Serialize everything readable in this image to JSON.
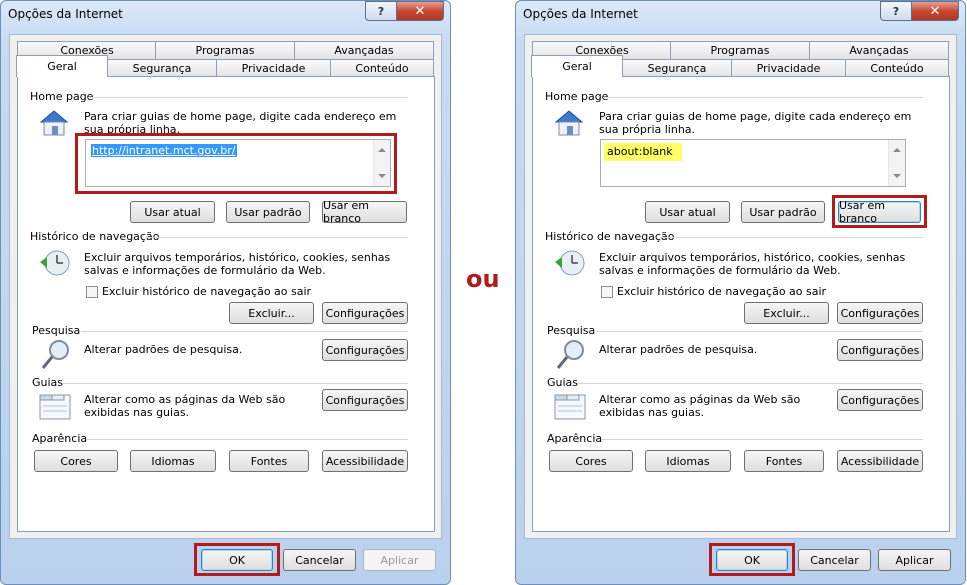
{
  "ou_label": "ou",
  "dialogs": [
    {
      "title": "Opções da Internet",
      "help_label": "?",
      "close_label": "✕",
      "tabs_row1": [
        "Conexões",
        "Programas",
        "Avançadas"
      ],
      "tabs_row2": [
        "Geral",
        "Segurança",
        "Privacidade",
        "Conteúdo"
      ],
      "home": {
        "label": "Home page",
        "desc": "Para criar guias de home page, digite cada endereço em sua própria linha.",
        "value": "http://intranet.mct.gov.br/",
        "btn_current": "Usar atual",
        "btn_default": "Usar padrão",
        "btn_blank": "Usar em branco"
      },
      "history": {
        "label": "Histórico de navegação",
        "desc": "Excluir arquivos temporários, histórico, cookies, senhas salvas e informações de formulário da Web.",
        "checkbox_label": "Excluir histórico de navegação ao sair",
        "btn_delete": "Excluir...",
        "btn_settings": "Configurações"
      },
      "search": {
        "label": "Pesquisa",
        "desc": "Alterar padrões de pesquisa.",
        "btn_settings": "Configurações"
      },
      "tabs_section": {
        "label": "Guias",
        "desc": "Alterar como as páginas da Web são exibidas nas guias.",
        "btn_settings": "Configurações"
      },
      "appearance": {
        "label": "Aparência",
        "btn_colors": "Cores",
        "btn_languages": "Idiomas",
        "btn_fonts": "Fontes",
        "btn_accessibility": "Acessibilidade"
      },
      "footer": {
        "ok": "OK",
        "cancel": "Cancelar",
        "apply": "Aplicar"
      }
    },
    {
      "title": "Opções da Internet",
      "help_label": "?",
      "close_label": "✕",
      "tabs_row1": [
        "Conexões",
        "Programas",
        "Avançadas"
      ],
      "tabs_row2": [
        "Geral",
        "Segurança",
        "Privacidade",
        "Conteúdo"
      ],
      "home": {
        "label": "Home page",
        "desc": "Para criar guias de home page, digite cada endereço em sua própria linha.",
        "value": "about:blank",
        "btn_current": "Usar atual",
        "btn_default": "Usar padrão",
        "btn_blank": "Usar em branco"
      },
      "history": {
        "label": "Histórico de navegação",
        "desc": "Excluir arquivos temporários, histórico, cookies, senhas salvas e informações de formulário da Web.",
        "checkbox_label": "Excluir histórico de navegação ao sair",
        "btn_delete": "Excluir...",
        "btn_settings": "Configurações"
      },
      "search": {
        "label": "Pesquisa",
        "desc": "Alterar padrões de pesquisa.",
        "btn_settings": "Configurações"
      },
      "tabs_section": {
        "label": "Guias",
        "desc": "Alterar como as páginas da Web são exibidas nas guias.",
        "btn_settings": "Configurações"
      },
      "appearance": {
        "label": "Aparência",
        "btn_colors": "Cores",
        "btn_languages": "Idiomas",
        "btn_fonts": "Fontes",
        "btn_accessibility": "Acessibilidade"
      },
      "footer": {
        "ok": "OK",
        "cancel": "Cancelar",
        "apply": "Aplicar"
      }
    }
  ],
  "colors": {
    "highlight": "#b31b1b",
    "selection": "#3399ff",
    "yellow_value": "#ffff66"
  }
}
